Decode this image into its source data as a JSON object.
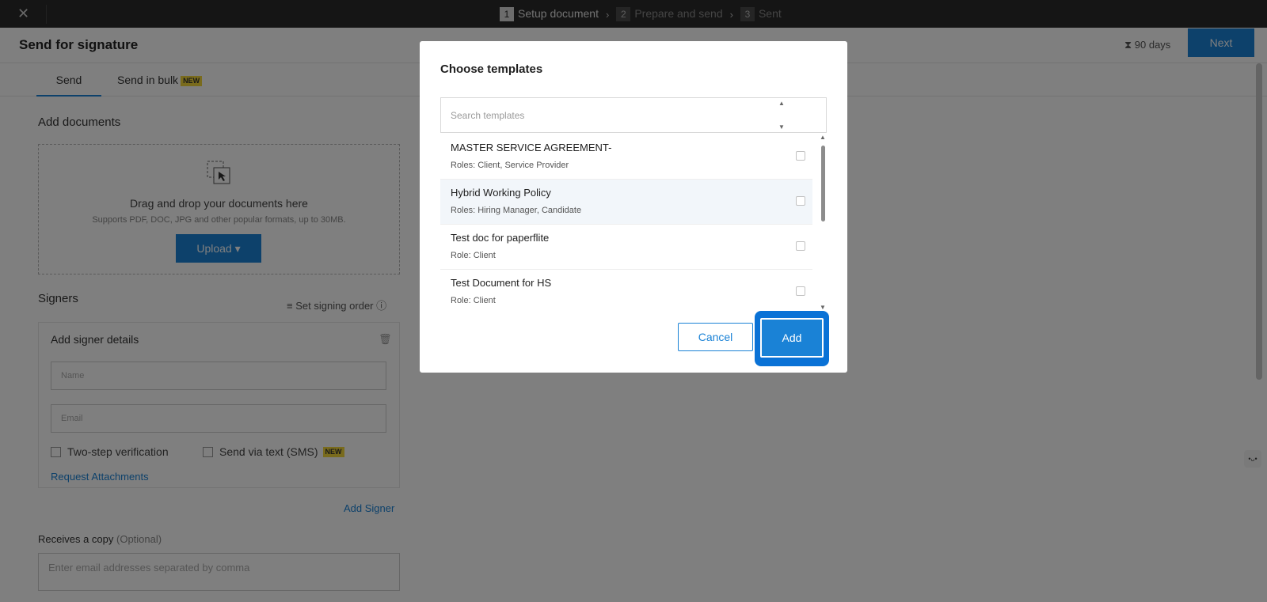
{
  "topbar": {
    "close_icon": "close-icon",
    "steps": [
      {
        "num": "1",
        "label": "Setup document"
      },
      {
        "num": "2",
        "label": "Prepare and send"
      },
      {
        "num": "3",
        "label": "Sent"
      }
    ],
    "separator": "›"
  },
  "header": {
    "title": "Send for signature",
    "expiry_icon": "hourglass-icon",
    "expiry": "90 days",
    "next_label": "Next"
  },
  "tabs": {
    "send": "Send",
    "bulk": "Send in bulk",
    "bulk_badge": "NEW"
  },
  "documents": {
    "title": "Add documents",
    "drop_title": "Drag and drop your documents here",
    "drop_subtitle": "Supports PDF, DOC, JPG and other popular formats, up to 30MB.",
    "upload_label": "Upload ▾"
  },
  "signers": {
    "title": "Signers",
    "set_order": "Set signing order",
    "card_title": "Add signer details",
    "name_placeholder": "Name",
    "email_placeholder": "Email",
    "two_step": "Two-step verification",
    "sms": "Send via text (SMS)",
    "sms_badge": "NEW",
    "request_attachments": "Request Attachments",
    "add_signer": "Add Signer"
  },
  "copy": {
    "title": "Receives a copy",
    "optional": "(Optional)",
    "placeholder": "Enter email addresses separated by comma"
  },
  "modal": {
    "title": "Choose templates",
    "search_placeholder": "Search templates",
    "templates": [
      {
        "name": "MASTER SERVICE AGREEMENT-",
        "roles": "Roles: Client,  Service Provider",
        "checked": false
      },
      {
        "name": "Hybrid Working Policy",
        "roles": "Roles: Hiring Manager,  Candidate",
        "checked": false
      },
      {
        "name": "Test doc for paperflite",
        "roles": "Role: Client",
        "checked": false
      },
      {
        "name": "Test Document for HS",
        "roles": "Role: Client",
        "checked": false
      }
    ],
    "cancel_label": "Cancel",
    "add_label": "Add"
  },
  "colors": {
    "accent": "#1a82d6",
    "highlight": "#0a72d6",
    "badge": "#f3d63a"
  }
}
